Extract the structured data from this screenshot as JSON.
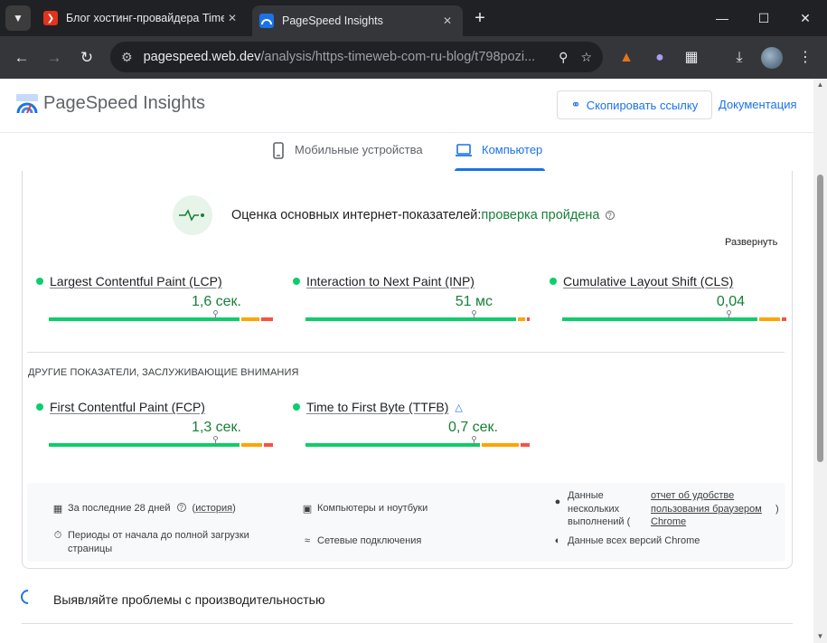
{
  "browser": {
    "tabs": [
      {
        "title": "Блог хостинг-провайдера Timeweb",
        "active": false
      },
      {
        "title": "PageSpeed Insights",
        "active": true
      }
    ],
    "url_host": "pagespeed.web.dev",
    "url_path": "/analysis/https-timeweb-com-ru-blog/t798pozi..."
  },
  "header": {
    "title": "PageSpeed Insights",
    "copy_link": "Скопировать ссылку",
    "docs": "Документация"
  },
  "device_tabs": {
    "mobile": "Мобильные устройства",
    "desktop": "Компьютер",
    "selected": "desktop"
  },
  "assessment": {
    "label": "Оценка основных интернет-показателей:",
    "result": "проверка пройдена",
    "expand": "Развернуть"
  },
  "metrics": [
    {
      "name": "Largest Contentful Paint (LCP)",
      "value": "1,6 сек.",
      "marker": 0.74,
      "good": 0.85,
      "ni": 0.94
    },
    {
      "name": "Interaction to Next Paint (INP)",
      "value": "51 мс",
      "marker": 0.75,
      "good": 0.94,
      "ni": 0.98
    },
    {
      "name": "Cumulative Layout Shift (CLS)",
      "value": "0,04",
      "marker": 0.74,
      "good": 0.87,
      "ni": 0.97
    }
  ],
  "other_metrics_label": "ДРУГИЕ ПОКАЗАТЕЛИ, ЗАСЛУЖИВАЮЩИЕ ВНИМАНИЯ",
  "other_metrics": [
    {
      "name": "First Contentful Paint (FCP)",
      "value": "1,3 сек.",
      "marker": 0.74,
      "good": 0.85,
      "ni": 0.95,
      "lab": false
    },
    {
      "name": "Time to First Byte (TTFB)",
      "value": "0,7 сек.",
      "marker": 0.75,
      "good": 0.78,
      "ni": 0.95,
      "lab": true
    }
  ],
  "info": {
    "period": "За последние 28 дней",
    "history": "история",
    "devices": "Компьютеры и ноутбуки",
    "samples": "Данные нескольких выполнений (",
    "samples_link": "отчет об удобстве пользования браузером Chrome",
    "samples_close": ")",
    "duration": "Периоды от начала до полной загрузки страницы",
    "network": "Сетевые подключения",
    "versions": "Данные всех версий Chrome"
  },
  "diagnose": {
    "title": "Выявляйте проблемы с производительностью"
  },
  "colors": {
    "good": "#0cce6b",
    "needs_improvement": "#ffa400",
    "poor": "#ff4e42",
    "accent": "#1a73e8",
    "pass_text": "#188038"
  },
  "icons": {
    "favicon_timeweb": "red-chevron",
    "favicon_psi": "psi-gauge",
    "mobile": "phone-icon",
    "desktop": "laptop-icon",
    "copy": "link-icon",
    "calendar": "calendar-icon",
    "stopwatch": "stopwatch-icon",
    "devices": "devices-icon",
    "wifi": "wifi-icon",
    "users": "users-icon",
    "chrome": "chrome-icon",
    "lab": "flask-icon"
  }
}
